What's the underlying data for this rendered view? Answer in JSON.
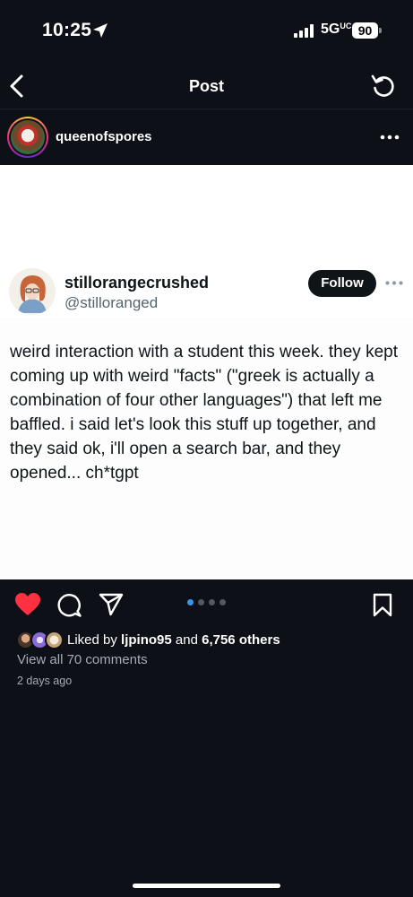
{
  "status_bar": {
    "time": "10:25",
    "network": "5G",
    "network_sub": "UC",
    "battery": "90"
  },
  "nav": {
    "title": "Post"
  },
  "post": {
    "username": "queenofspores"
  },
  "tweet": {
    "display_name": "stillorangecrushed",
    "handle": "@stilloranged",
    "follow_label": "Follow",
    "text": "weird interaction with a student this week. they kept coming up with weird \"facts\" (\"greek is actually a combination of four other languages\") that left me baffled. i said let's look this stuff up together, and they said ok, i'll open a search bar, and they opened... ch*tgpt"
  },
  "actions": {
    "liked": true,
    "carousel_total": 4,
    "carousel_active": 1
  },
  "likes": {
    "prefix": "Liked by",
    "user": "ljpino95",
    "conjunction": "and",
    "others": "6,756 others"
  },
  "comments": {
    "view_all": "View all 70 comments"
  },
  "meta": {
    "time_ago": "2 days ago"
  },
  "colors": {
    "background": "#0d1016",
    "heart": "#ff3040",
    "carousel_active": "#3797f0",
    "follow_button": "#0f1419"
  }
}
